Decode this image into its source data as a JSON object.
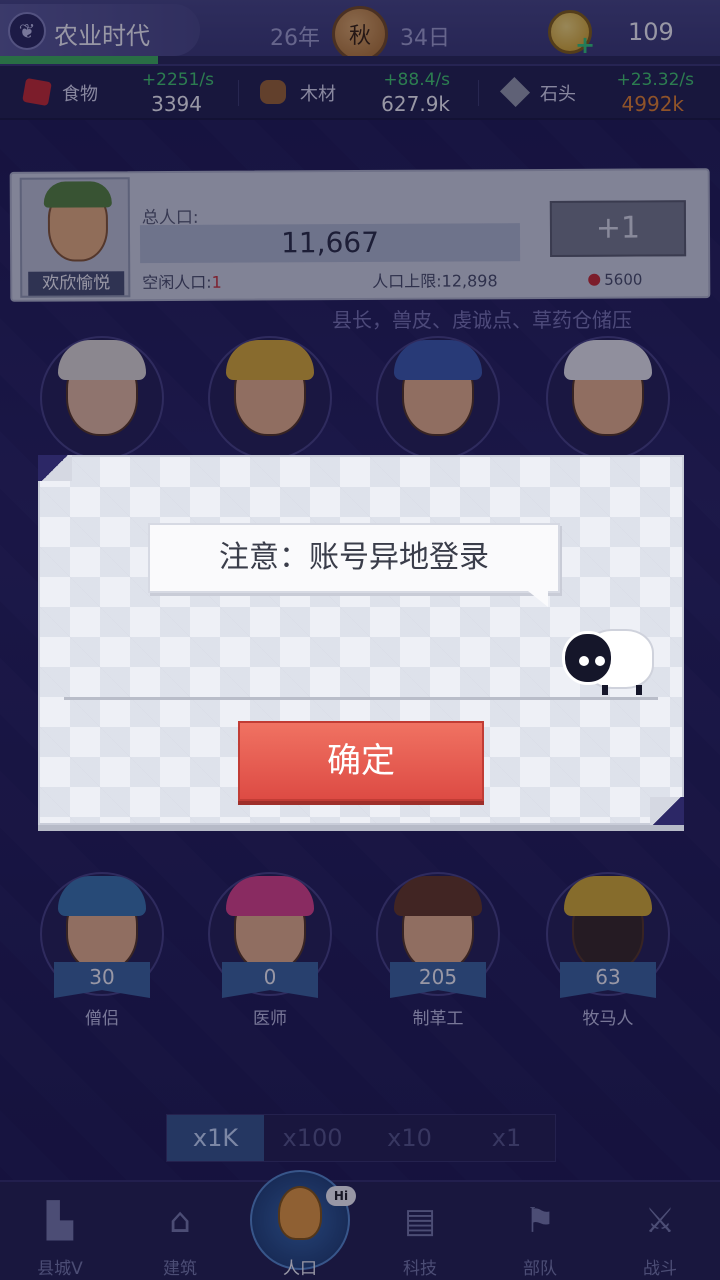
{
  "header": {
    "era": "农业时代",
    "year": "26年",
    "season": "秋",
    "day": "34日",
    "coins": "109",
    "era_progress": 0.22
  },
  "resources": [
    {
      "name": "食物",
      "rate": "+2251/s",
      "amount": "3394",
      "warn": false,
      "color": "#cf2d2d"
    },
    {
      "name": "木材",
      "rate": "+88.4/s",
      "amount": "627.9k",
      "warn": false,
      "color": "#a36a2f"
    },
    {
      "name": "石头",
      "rate": "+23.32/s",
      "amount": "4992k",
      "warn": true,
      "color": "#9ea3ae"
    }
  ],
  "population": {
    "mood": "欢欣愉悦",
    "total_label": "总人口:",
    "total": "11,667",
    "idle_label": "空闲人口:",
    "idle": "1",
    "cap_label": "人口上限:",
    "cap": "12,898",
    "add_label": "+1",
    "add_cost": "5600",
    "notice": "县长，兽皮、虔诚点、草药仓储压"
  },
  "characters_top": [
    {
      "hair": "#e9e4da",
      "skin": "#efc3a0"
    },
    {
      "hair": "#e4b433",
      "skin": "#f1b88a"
    },
    {
      "hair": "#3f5fb0",
      "skin": "#f1b88a"
    },
    {
      "hair": "#f2f2f2",
      "skin": "#f1b88a"
    }
  ],
  "characters_bottom": [
    {
      "label": "僧侣",
      "count": "30",
      "hair": "#3d7ab0",
      "skin": "#f1b88a"
    },
    {
      "label": "医师",
      "count": "0",
      "hair": "#e5458b",
      "skin": "#f1b88a"
    },
    {
      "label": "制革工",
      "count": "205",
      "hair": "#6a3b1f",
      "skin": "#f1b88a"
    },
    {
      "label": "牧马人",
      "count": "63",
      "hair": "#e0b530",
      "skin": "#3a2a20"
    }
  ],
  "dialog": {
    "message": "注意：账号异地登录",
    "confirm": "确定"
  },
  "speed": {
    "options": [
      "x1K",
      "x100",
      "x10",
      "x1"
    ],
    "active": 0
  },
  "nav": [
    {
      "label": "县城V",
      "icon": "castle-icon"
    },
    {
      "label": "建筑",
      "icon": "house-icon"
    },
    {
      "label": "人口",
      "icon": "person-icon",
      "active": true,
      "badge": "Hi"
    },
    {
      "label": "科技",
      "icon": "book-icon"
    },
    {
      "label": "部队",
      "icon": "banner-icon"
    },
    {
      "label": "战斗",
      "icon": "swords-icon"
    }
  ]
}
